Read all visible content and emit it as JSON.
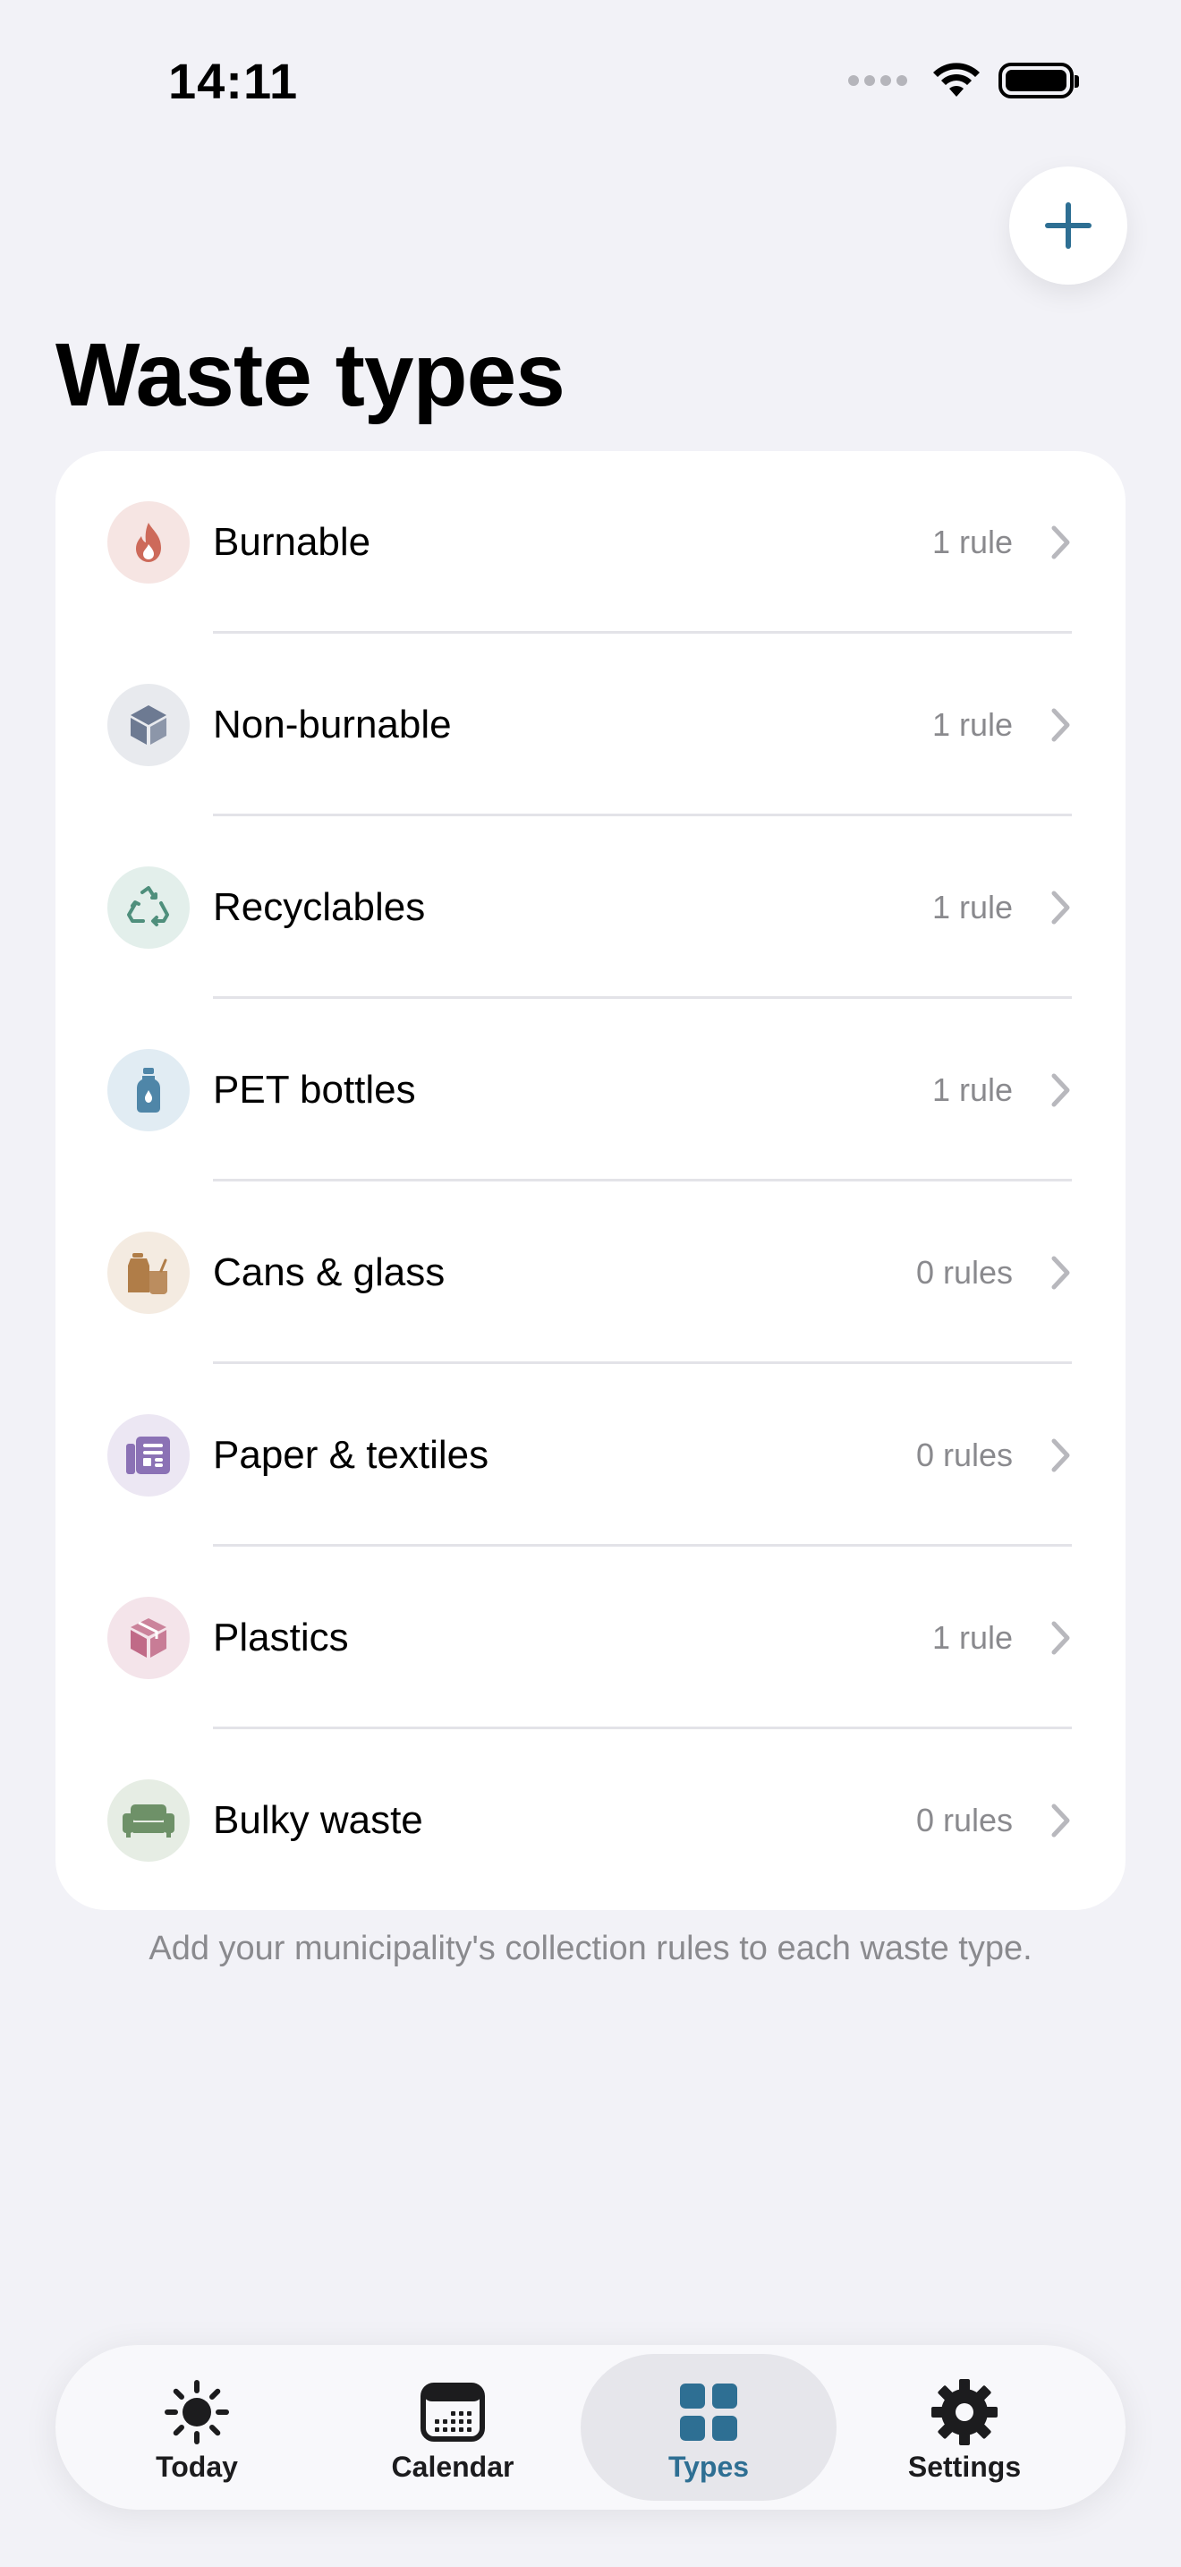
{
  "status_bar": {
    "time": "14:11"
  },
  "header": {
    "title": "Waste types",
    "add_icon": "plus-icon"
  },
  "colors": {
    "accent": "#2e6f93",
    "background": "#f2f2f7",
    "secondary_text": "#8a8a8e"
  },
  "waste_types": [
    {
      "label": "Burnable",
      "count": "1 rule",
      "icon": "flame-icon",
      "icon_color": "#cd6a5a",
      "bg_color": "#f6e5e3"
    },
    {
      "label": "Non-burnable",
      "count": "1 rule",
      "icon": "cube-icon",
      "icon_color": "#6d7a92",
      "bg_color": "#e8eaee"
    },
    {
      "label": "Recyclables",
      "count": "1 rule",
      "icon": "recycle-icon",
      "icon_color": "#4f8f7c",
      "bg_color": "#e3efeb"
    },
    {
      "label": "PET bottles",
      "count": "1 rule",
      "icon": "bottle-icon",
      "icon_color": "#4f86a8",
      "bg_color": "#e1ecf3"
    },
    {
      "label": "Cans & glass",
      "count": "0 rules",
      "icon": "can-icon",
      "icon_color": "#b07d48",
      "bg_color": "#f4ebe1"
    },
    {
      "label": "Paper & textiles",
      "count": "0 rules",
      "icon": "newspaper-icon",
      "icon_color": "#8b72b5",
      "bg_color": "#ece7f3"
    },
    {
      "label": "Plastics",
      "count": "1 rule",
      "icon": "package-icon",
      "icon_color": "#c06a87",
      "bg_color": "#f4e4ea"
    },
    {
      "label": "Bulky waste",
      "count": "0 rules",
      "icon": "sofa-icon",
      "icon_color": "#6e9168",
      "bg_color": "#e6ede4"
    }
  ],
  "footer_note": "Add your municipality's collection rules to each waste type.",
  "tab_bar": {
    "tabs": [
      {
        "label": "Today",
        "icon": "sun-icon",
        "active": false
      },
      {
        "label": "Calendar",
        "icon": "calendar-icon",
        "active": false
      },
      {
        "label": "Types",
        "icon": "grid-icon",
        "active": true
      },
      {
        "label": "Settings",
        "icon": "gear-icon",
        "active": false
      }
    ]
  }
}
